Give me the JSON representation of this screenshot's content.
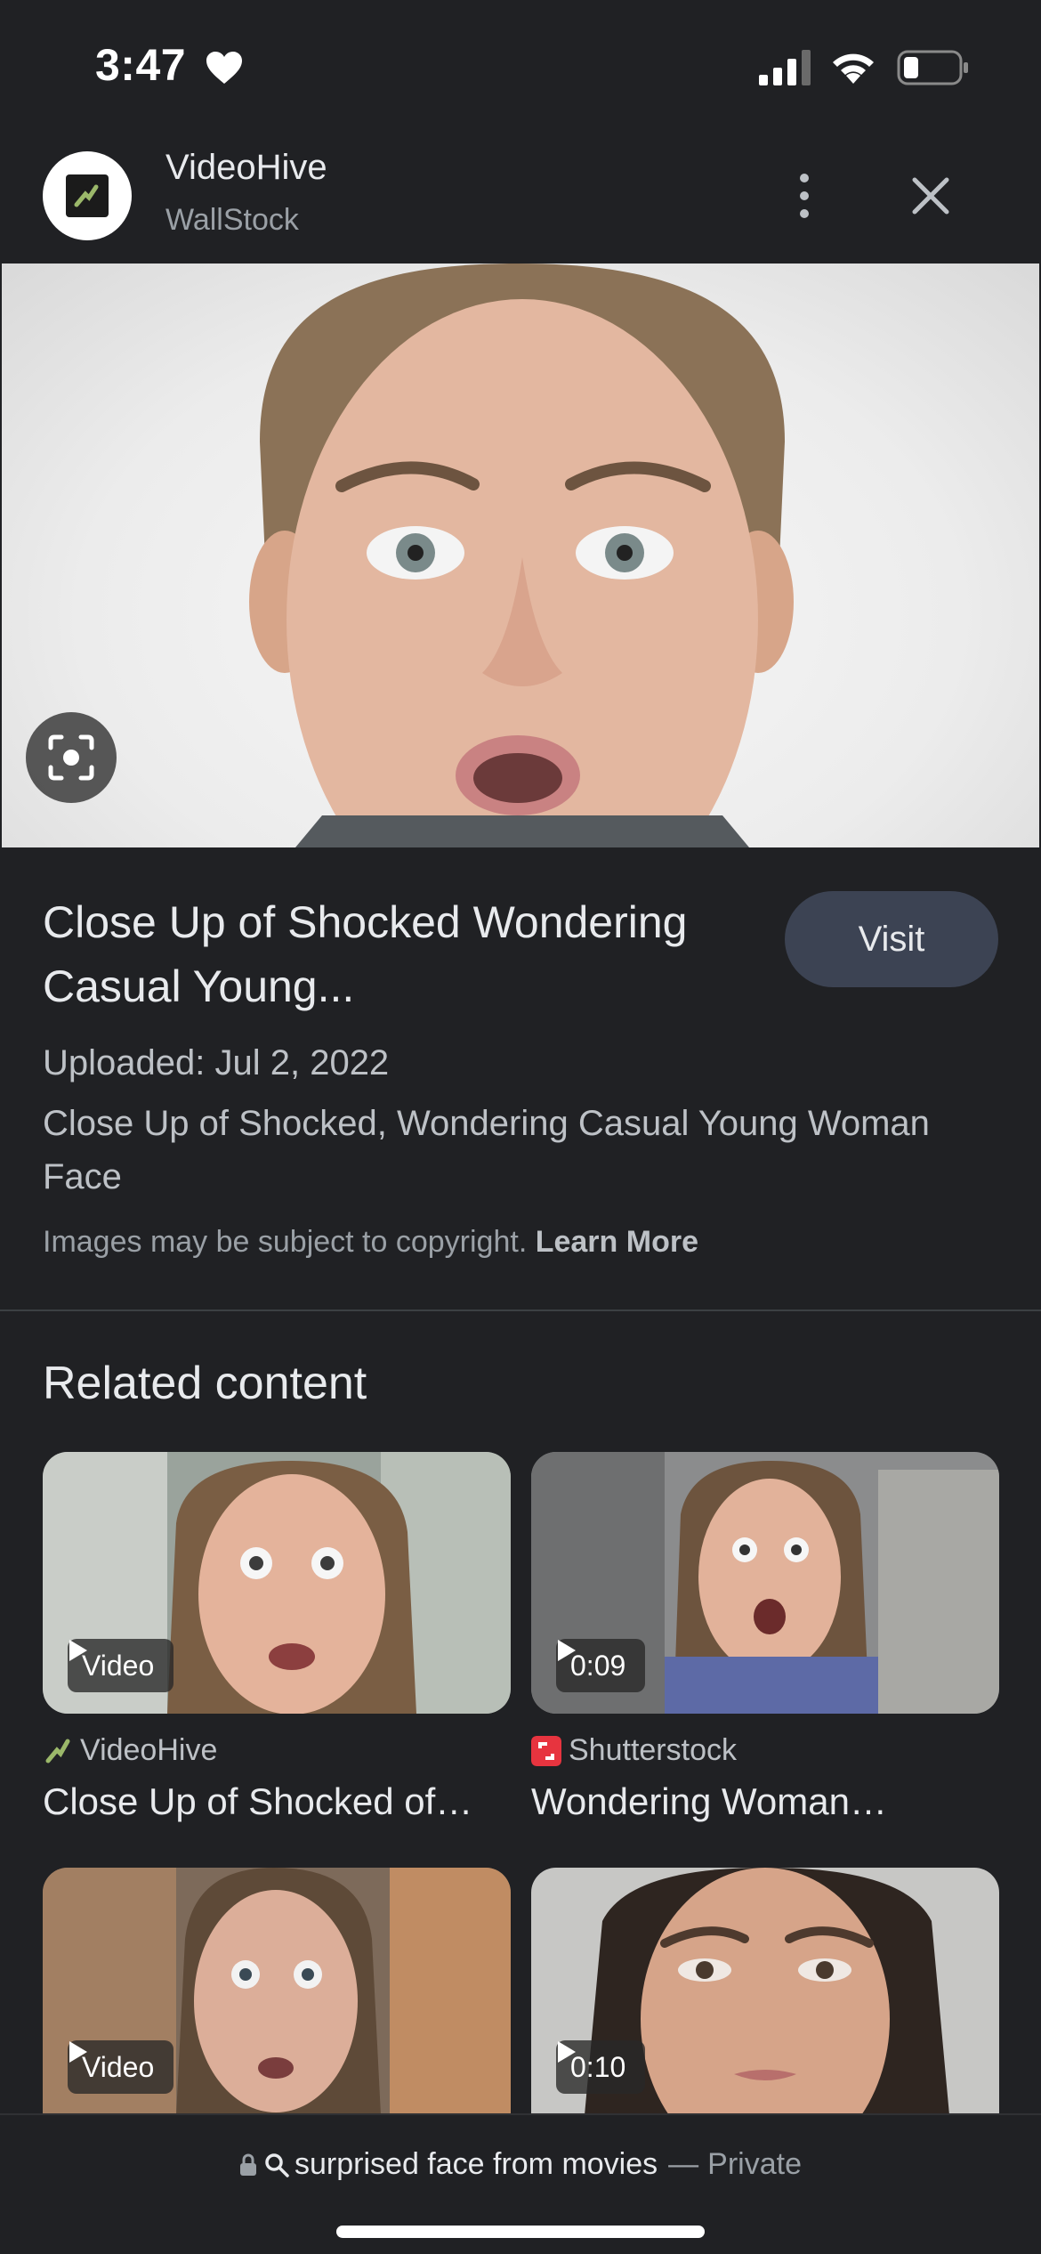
{
  "status_bar": {
    "time": "3:47",
    "icons": [
      "heart-icon",
      "cellular-signal-icon",
      "wifi-icon",
      "battery-icon"
    ]
  },
  "header": {
    "site_name": "VideoHive",
    "site_subname": "WallStock",
    "icons": [
      "more-vert-icon",
      "close-icon"
    ]
  },
  "hero": {
    "lens_icon": "lens-search-icon"
  },
  "result": {
    "title": "Close Up of Shocked Wondering Casual Young...",
    "visit_label": "Visit",
    "uploaded": "Uploaded: Jul 2, 2022",
    "description": "Close Up of Shocked, Wondering Casual Young Woman Face",
    "copyright_text": "Images may be subject to copyright.",
    "learn_more": "Learn More"
  },
  "related": {
    "heading": "Related content",
    "items": [
      {
        "badge": "Video",
        "source": "VideoHive",
        "title": "Close Up of Shocked of…"
      },
      {
        "badge": "0:09",
        "source": "Shutterstock",
        "title": "Wondering Woman…"
      },
      {
        "badge": "Video"
      },
      {
        "badge": "0:10"
      }
    ]
  },
  "address_bar": {
    "query": "surprised face from movies",
    "separator": "—",
    "mode": "Private"
  },
  "colors": {
    "background": "#202124",
    "visit_button": "#3c4353",
    "shutterstock_red": "#e7343f"
  }
}
